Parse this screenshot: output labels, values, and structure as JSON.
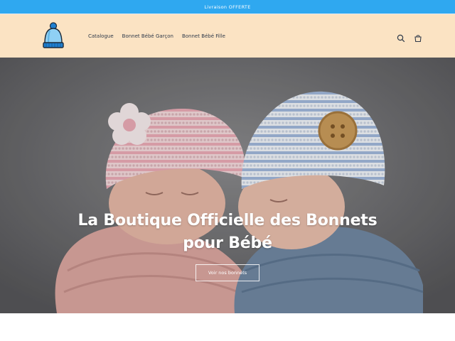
{
  "announcement": {
    "text": "Livraison OFFERTE"
  },
  "header": {
    "logo_icon": "baby-beanie-logo",
    "nav": [
      {
        "label": "Catalogue"
      },
      {
        "label": "Bonnet Bébé Garçon"
      },
      {
        "label": "Bonnet Bébé Fille"
      }
    ],
    "icons": [
      "search-icon",
      "cart-icon"
    ]
  },
  "hero": {
    "title_line1": "La Boutique Officielle des Bonnets",
    "title_line2": "pour Bébé",
    "button_label": "Voir nos bonnets"
  },
  "colors": {
    "announcement_bg": "#2fa8f0",
    "header_bg": "#fbe3c3",
    "nav_text": "#2f3a4a"
  }
}
